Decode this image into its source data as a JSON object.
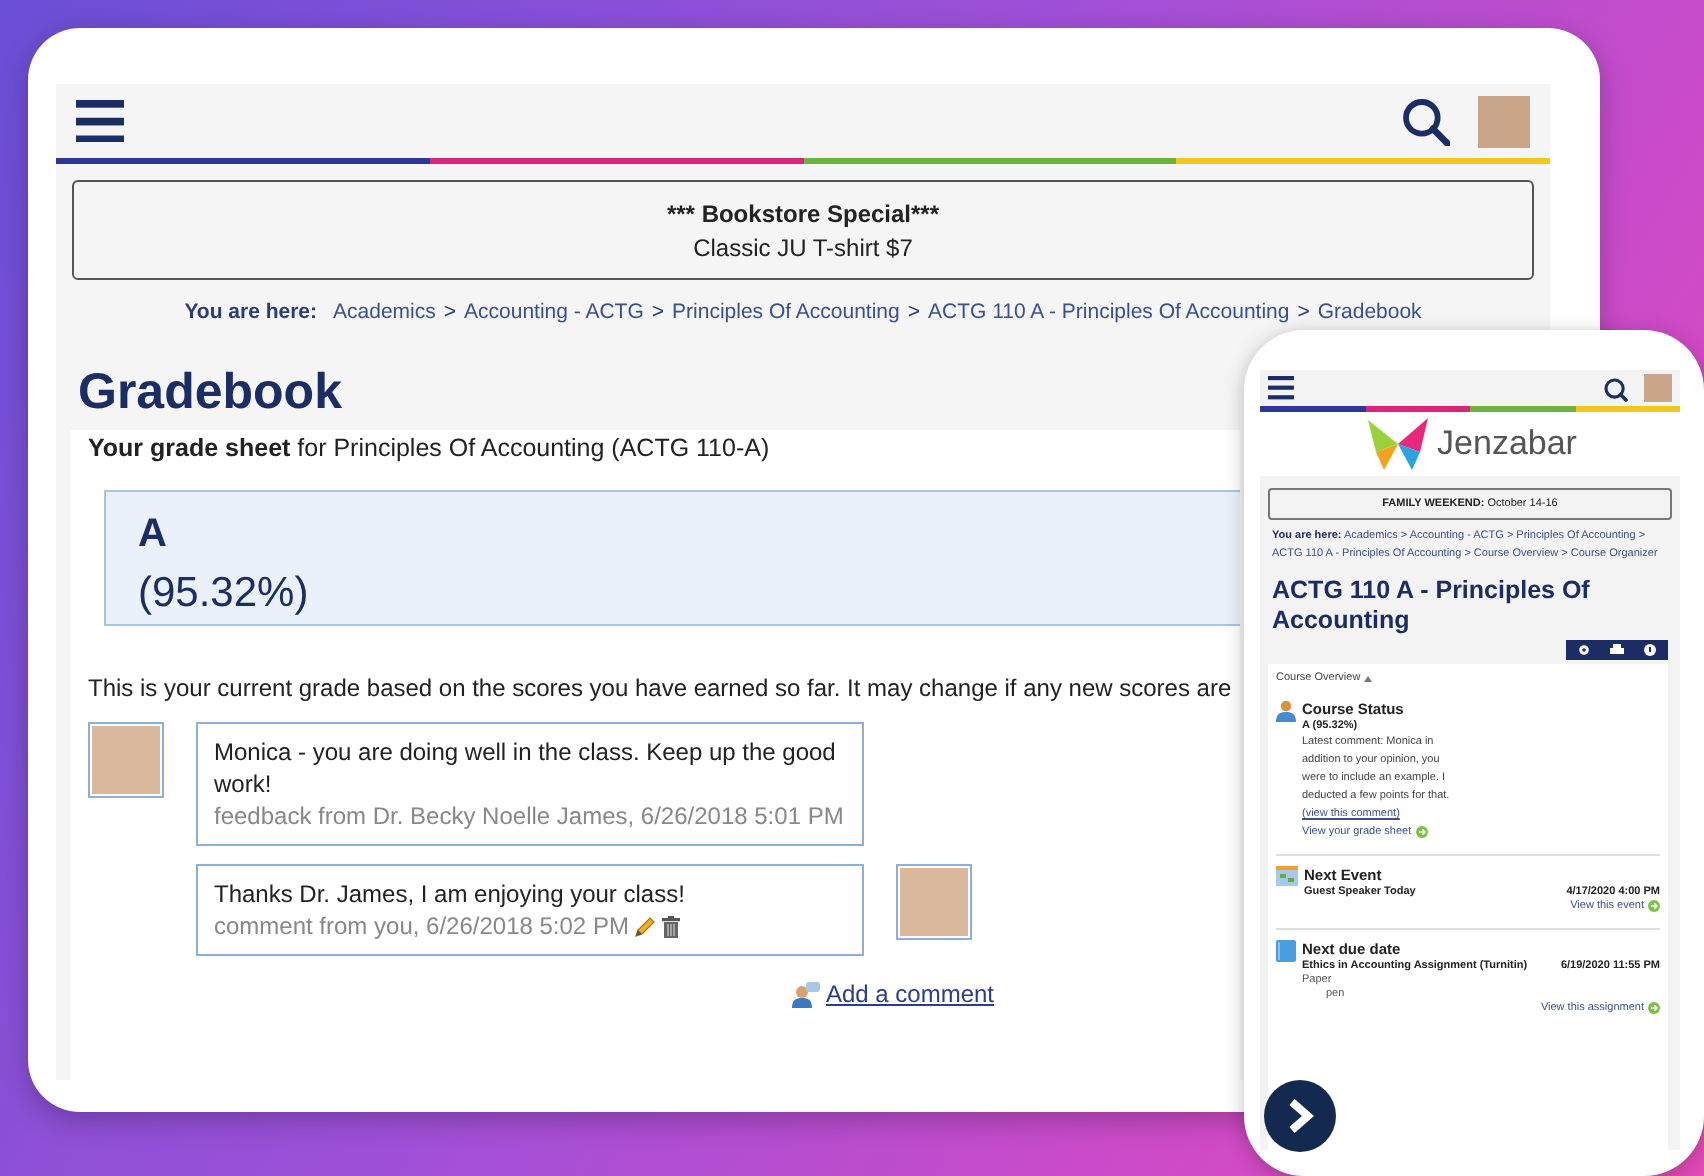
{
  "tablet": {
    "announcement": {
      "title": "*** Bookstore Special***",
      "text": "Classic JU T-shirt $7"
    },
    "breadcrumb": {
      "label": "You are here:",
      "separator": ">",
      "items": [
        "Academics",
        "Accounting - ACTG",
        "Principles Of Accounting",
        "ACTG 110 A - Principles Of Accounting",
        "Gradebook"
      ]
    },
    "title": "Gradebook",
    "grade_sheet": "**Your grade sheet** for Principles Of Accounting (ACTG 110-A)",
    "grade": {
      "letter": "A",
      "percent": "(95.32%)"
    },
    "note": "This is your current grade based on the scores you have earned so far. It may change if any new scores are",
    "comments": [
      {
        "kind": "feedback",
        "text": "Monica - you are doing well in the class.  Keep up the good work!",
        "meta": "feedback from Dr. Becky Noelle James, 6/26/2018 5:01 PM"
      },
      {
        "kind": "own",
        "text": "Thanks Dr. James, I am enjoying your class!",
        "meta": "comment from you, 6/26/2018 5:02 PM"
      }
    ],
    "add_comment": "Add a comment"
  },
  "phone": {
    "logo": "Jenzabar",
    "announcement": "**FAMILY WEEKEND:** October 14-16",
    "breadcrumb": {
      "label": "You are here:",
      "text": "Academics > Accounting - ACTG > Principles Of Accounting > ACTG 110 A - Principles Of Accounting > Course Overview > Course Organizer"
    },
    "title": "ACTG 110 A - Principles Of Accounting",
    "section": "Course Overview",
    "items": [
      {
        "kind": "status",
        "title": "Course Status",
        "grade": "A (95.32%)",
        "comment": "Latest comment: Monica in addition to your opinion, you were to include an example.  I deducted a few points for that.",
        "comment_link": "(view this comment)",
        "link": "View your grade sheet"
      },
      {
        "kind": "event",
        "title": "Next Event",
        "name": "Guest Speaker Today",
        "date": "4/17/2020 4:00 PM",
        "link": "View this event"
      },
      {
        "kind": "due",
        "title": "Next due date",
        "name": "Ethics in Accounting Assignment (Turnitin)",
        "date": "6/19/2020 11:55 PM",
        "lines": [
          "Paper",
          "pen"
        ],
        "link": "View this assignment"
      }
    ]
  }
}
